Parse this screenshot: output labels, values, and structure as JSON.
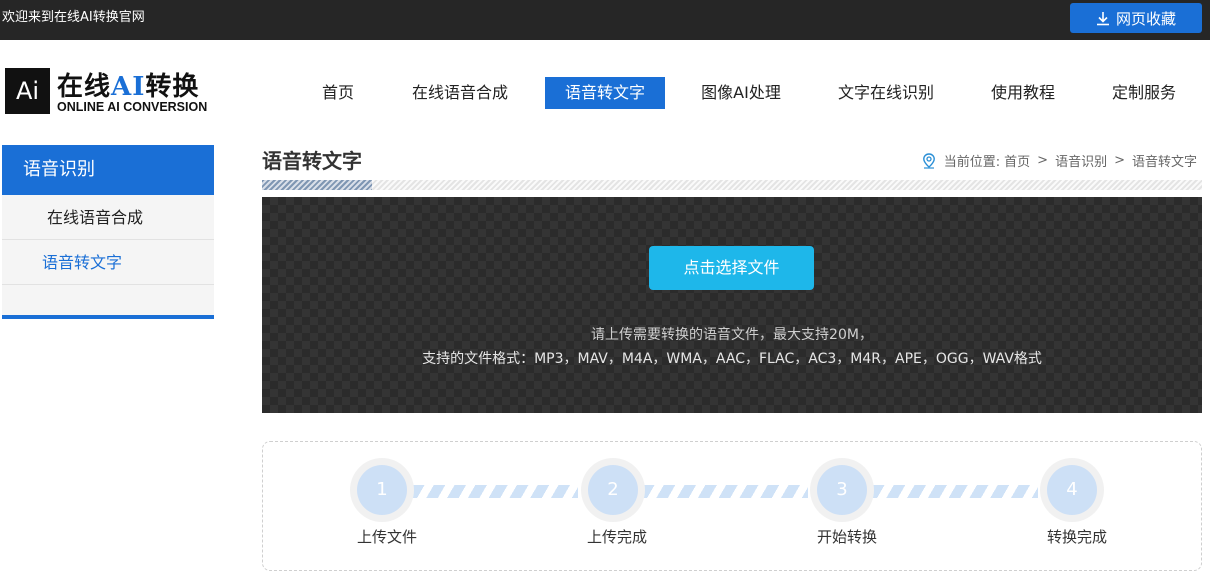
{
  "topbar": {
    "welcome": "欢迎来到在线AI转换官网",
    "favorite_label": "网页收藏",
    "favorite_icon": "download-icon"
  },
  "logo": {
    "box_text": "Ai",
    "title_part1": "在线",
    "title_ai": "AI",
    "title_part2": "转换",
    "subtitle": "ONLINE AI CONVERSION"
  },
  "nav": {
    "items": [
      {
        "label": "首页"
      },
      {
        "label": "在线语音合成"
      },
      {
        "label": "语音转文字",
        "active": true
      },
      {
        "label": "图像AI处理"
      },
      {
        "label": "文字在线识别"
      },
      {
        "label": "使用教程"
      },
      {
        "label": "定制服务"
      }
    ]
  },
  "sidebar": {
    "title": "语音识别",
    "items": [
      {
        "label": "在线语音合成"
      },
      {
        "label": "语音转文字",
        "active": true
      }
    ]
  },
  "main": {
    "title": "语音转文字",
    "breadcrumb": {
      "icon": "location-pin-icon",
      "prefix": "当前位置:",
      "items": [
        "首页",
        "语音识别",
        "语音转文字"
      ],
      "separator": ">"
    },
    "upload": {
      "button_label": "点击选择文件",
      "hint_line1": "请上传需要转换的语音文件，最大支持20M，",
      "hint_line2": "支持的文件格式：MP3，MAV，M4A，WMA，AAC，FLAC，AC3，M4R，APE，OGG，WAV格式"
    },
    "steps": [
      {
        "number": "1",
        "label": "上传文件"
      },
      {
        "number": "2",
        "label": "上传完成"
      },
      {
        "number": "3",
        "label": "开始转换"
      },
      {
        "number": "4",
        "label": "转换完成"
      }
    ]
  },
  "colors": {
    "accent": "#1a6fd6",
    "upload_button": "#1eb7ea",
    "topbar": "#262626",
    "panel": "#2b2b2b"
  }
}
